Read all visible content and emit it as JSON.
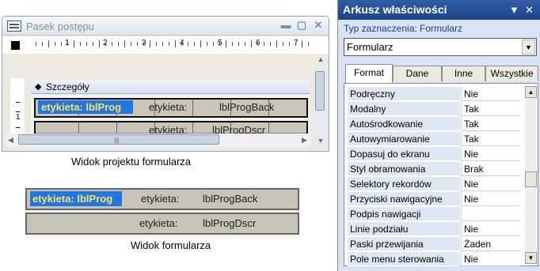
{
  "design_window": {
    "title": "Pasek postępu",
    "minimize": "▬",
    "restore": "▢",
    "close": "✕",
    "ruler_numbers": [
      "1",
      "2",
      "3",
      "4",
      "5",
      "6",
      "7"
    ],
    "left_ruler_number": "1",
    "section_label": "Szczegóły",
    "row1": {
      "selected_label": "etykieta:  lblProg",
      "label": "etykieta:",
      "value": "lblProgBack"
    },
    "row2": {
      "label": "etykieta:",
      "value": "lblProgDscr"
    },
    "caption": "Widok projektu formularza"
  },
  "form_view": {
    "row1": {
      "selected_label": "etykieta:  lblProg",
      "label": "etykieta:",
      "value": "lblProgBack"
    },
    "row2": {
      "label": "etykieta:",
      "value": "lblProgDscr"
    },
    "caption": "Widok formularza"
  },
  "property_sheet": {
    "title": "Arkusz właściwości",
    "selection_type": "Typ zaznaczenia:  Formularz",
    "object": "Formularz",
    "tabs": [
      "Format",
      "Dane",
      "Inne",
      "Wszystkie"
    ],
    "active_tab": "Format",
    "properties": [
      {
        "name": "Podręczny",
        "value": "Nie"
      },
      {
        "name": "Modalny",
        "value": "Tak"
      },
      {
        "name": "Autośrodkowanie",
        "value": "Tak"
      },
      {
        "name": "Autowymiarowanie",
        "value": "Tak"
      },
      {
        "name": "Dopasuj do ekranu",
        "value": "Nie"
      },
      {
        "name": "Styl obramowania",
        "value": "Brak"
      },
      {
        "name": "Selektory rekordów",
        "value": "Nie"
      },
      {
        "name": "Przyciski nawigacyjne",
        "value": "Nie"
      },
      {
        "name": "Podpis nawigacji",
        "value": ""
      },
      {
        "name": "Linie podziału",
        "value": "Nie"
      },
      {
        "name": "Paski przewijania",
        "value": "Żaden"
      },
      {
        "name": "Pole menu sterowania",
        "value": "Nie"
      }
    ]
  },
  "colors": {
    "selected_label_bg": "#1e77e5",
    "selected_label_text": "#ffe34a",
    "band_bg": "#c9c5b8",
    "ps_title_bg": "#2f5da6"
  }
}
